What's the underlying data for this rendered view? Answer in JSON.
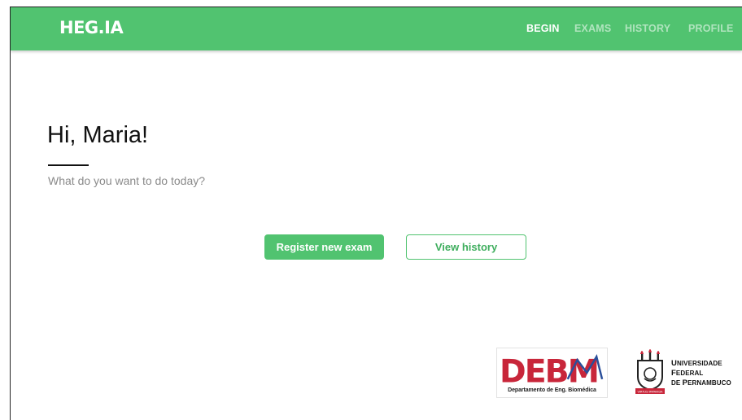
{
  "brand": {
    "name": "HEG.IA"
  },
  "nav": {
    "items": [
      {
        "label": "BEGIN",
        "active": true
      },
      {
        "label": "EXAMS",
        "active": false
      },
      {
        "label": "HISTORY",
        "active": false
      },
      {
        "label": "PROFILE",
        "active": false
      }
    ]
  },
  "main": {
    "greeting": "Hi, Maria!",
    "subtitle": "What do you want to do today?",
    "primary_button": "Register new exam",
    "secondary_button": "View history"
  },
  "footer": {
    "debm": {
      "logo_text": "DEBM",
      "caption": "Departamento de Eng. Biomédica"
    },
    "ufpe": {
      "line1": "Universidade",
      "line2": "Federal",
      "line3": "de Pernambuco",
      "crest_ribbon": "VIRTUS IMPAVIDA"
    }
  },
  "colors": {
    "accent": "#51c370",
    "debm_red": "#c8263a",
    "debm_blue": "#2a4f9a"
  }
}
